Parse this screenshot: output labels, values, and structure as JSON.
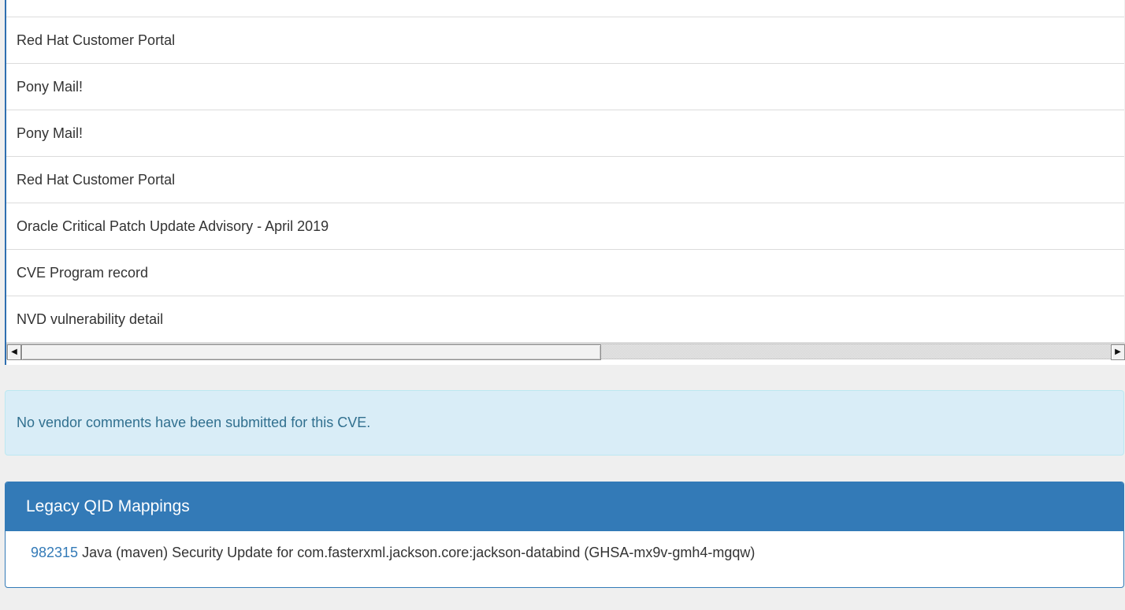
{
  "references": {
    "items": [
      "Red Hat Customer Portal",
      "Pony Mail!",
      "Pony Mail!",
      "Red Hat Customer Portal",
      "Oracle Critical Patch Update Advisory - April 2019",
      "CVE Program record",
      "NVD vulnerability detail"
    ]
  },
  "scrollbar": {
    "left_arrow": "◀",
    "right_arrow": "▶"
  },
  "vendor_comments": {
    "message": "No vendor comments have been submitted for this CVE."
  },
  "legacy_qid": {
    "heading": "Legacy QID Mappings",
    "mapping": {
      "qid": "982315",
      "title": "Java (maven) Security Update for com.fasterxml.jackson.core:jackson-databind (GHSA-mx9v-gmh4-mgqw)"
    }
  },
  "colors": {
    "panel_primary": "#337ab7",
    "info_background": "#d9edf7",
    "info_text": "#31708f"
  }
}
